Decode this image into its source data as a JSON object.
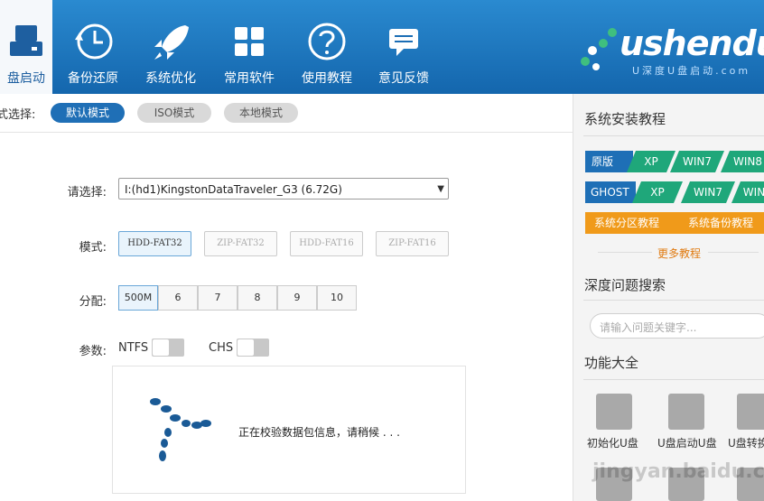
{
  "nav": {
    "items": [
      {
        "label": "盘启动",
        "icon": "usb-drive-icon"
      },
      {
        "label": "备份还原",
        "icon": "history-clock-icon"
      },
      {
        "label": "系统优化",
        "icon": "rocket-icon"
      },
      {
        "label": "常用软件",
        "icon": "grid-apps-icon"
      },
      {
        "label": "使用教程",
        "icon": "help-circle-icon"
      },
      {
        "label": "意见反馈",
        "icon": "chat-bubble-icon"
      }
    ],
    "logo_text": "ushendu",
    "logo_sub": "U深度U盘启动.com"
  },
  "mode": {
    "lead": "式选择:",
    "options": [
      "默认模式",
      "ISO模式",
      "本地模式"
    ],
    "selected": "默认模式"
  },
  "form": {
    "select_label": "请选择:",
    "select_value": "I:(hd1)KingstonDataTraveler_G3 (6.72G)",
    "mode_label": "模式:",
    "formats": [
      "HDD-FAT32",
      "ZIP-FAT32",
      "HDD-FAT16",
      "ZIP-FAT16"
    ],
    "alloc_label": "分配:",
    "partitions": [
      "500M",
      "6",
      "7",
      "8",
      "9",
      "10"
    ],
    "params_label": "参数:",
    "ntfs": "NTFS",
    "chs": "CHS",
    "status": "正在校验数据包信息，请稍候 . . ."
  },
  "side": {
    "tutorial_title": "系统安装教程",
    "row1": [
      "原版",
      "XP",
      "WIN7",
      "WIN8"
    ],
    "row2": [
      "GHOST",
      "XP",
      "WIN7",
      "WIN"
    ],
    "orange": [
      "系统分区教程",
      "系统备份教程"
    ],
    "more": "更多教程",
    "search_title": "深度问题搜索",
    "search_placeholder": "请输入问题关键字...",
    "tools_title": "功能大全",
    "tools": [
      "初始化U盘",
      "U盘启动U盘",
      "U盘转换"
    ],
    "watermark": "jingyan.baidu.com"
  },
  "colors": {
    "header": "#1a73bd",
    "accent": "#1f6fb6",
    "green": "#1fa77a",
    "orange": "#f09a1a"
  }
}
